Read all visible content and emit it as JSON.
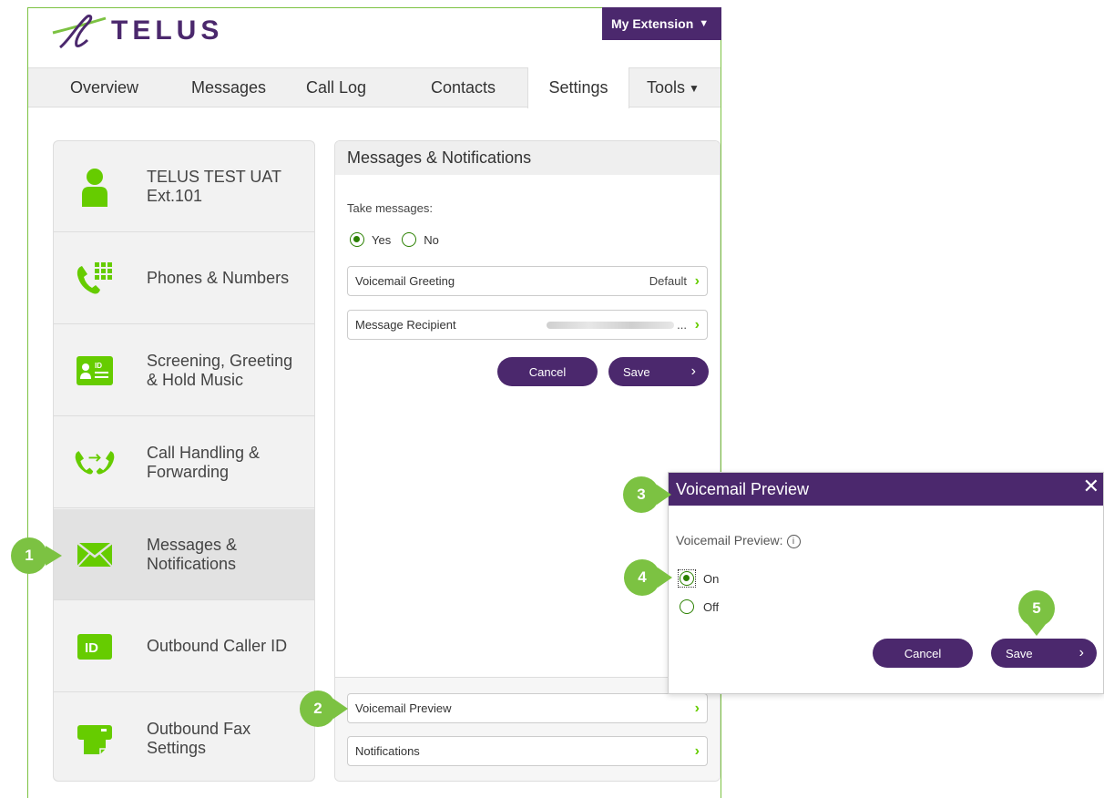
{
  "brand": {
    "name": "TELUS",
    "color": "#4b286d",
    "accent": "#7cc242"
  },
  "header": {
    "extension_label": "My Extension"
  },
  "nav": {
    "tabs": [
      {
        "label": "Overview"
      },
      {
        "label": "Messages"
      },
      {
        "label": "Call Log"
      },
      {
        "label": "Contacts"
      },
      {
        "label": "Settings",
        "active": true
      },
      {
        "label": "Tools"
      }
    ]
  },
  "sidebar": {
    "items": [
      {
        "label_line1": "TELUS TEST UAT",
        "label_line2": "Ext.101",
        "icon": "user-icon"
      },
      {
        "label_line1": "Phones & Numbers",
        "label_line2": "",
        "icon": "phone-keypad-icon"
      },
      {
        "label_line1": "Screening, Greeting",
        "label_line2": "& Hold Music",
        "icon": "id-card-icon"
      },
      {
        "label_line1": "Call Handling &",
        "label_line2": "Forwarding",
        "icon": "call-forward-icon"
      },
      {
        "label_line1": "Messages &",
        "label_line2": "Notifications",
        "icon": "envelope-icon",
        "active": true
      },
      {
        "label_line1": "Outbound Caller ID",
        "label_line2": "",
        "icon": "id-badge-icon"
      },
      {
        "label_line1": "Outbound Fax",
        "label_line2": "Settings",
        "icon": "fax-icon"
      }
    ]
  },
  "panel": {
    "title": "Messages & Notifications",
    "take_messages_label": "Take messages:",
    "yes_label": "Yes",
    "no_label": "No",
    "take_messages_value": "Yes",
    "voicemail_greeting_label": "Voicemail Greeting",
    "voicemail_greeting_value": "Default",
    "message_recipient_label": "Message Recipient",
    "message_recipient_ellipsis": "...",
    "cancel_label": "Cancel",
    "save_label": "Save",
    "voicemail_preview_label": "Voicemail Preview",
    "notifications_label": "Notifications"
  },
  "modal": {
    "title": "Voicemail Preview",
    "field_label": "Voicemail Preview:",
    "on_label": "On",
    "off_label": "Off",
    "selected": "On",
    "cancel_label": "Cancel",
    "save_label": "Save"
  },
  "steps": [
    "1",
    "2",
    "3",
    "4",
    "5"
  ]
}
